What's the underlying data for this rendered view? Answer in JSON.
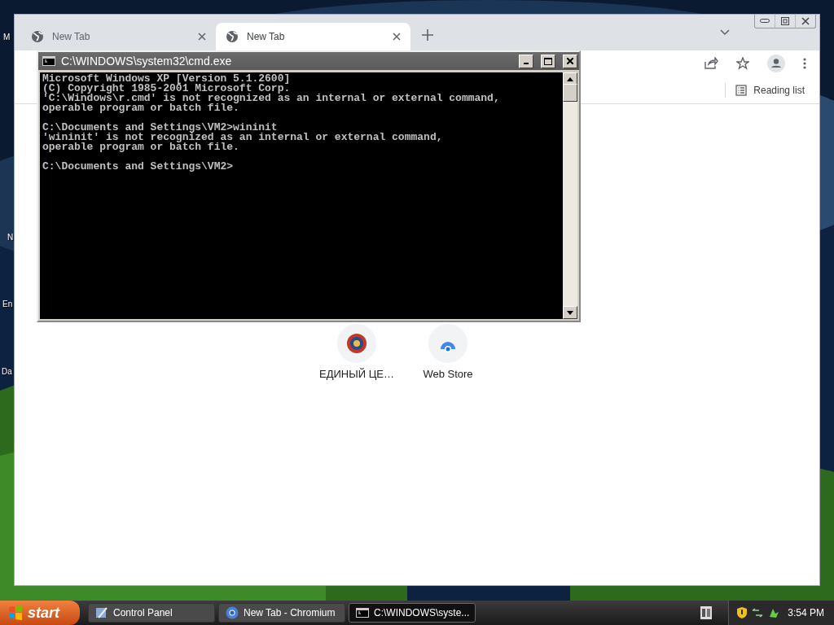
{
  "desktop": {
    "icons": [
      {
        "label": "M"
      },
      {
        "label": "N"
      },
      {
        "label": "En"
      },
      {
        "label": "Da"
      }
    ]
  },
  "browser": {
    "tabs": [
      {
        "title": "New Tab",
        "selected": false
      },
      {
        "title": "New Tab",
        "selected": true
      }
    ],
    "reading_list": "Reading list",
    "shortcuts": [
      {
        "title": "ЕДИНЫЙ ЦЕ…",
        "kind": "emblem"
      },
      {
        "title": "Web Store",
        "kind": "store"
      }
    ]
  },
  "console": {
    "title": "C:\\WINDOWS\\system32\\cmd.exe",
    "blocks": [
      [
        "Microsoft Windows XP [Version 5.1.2600]",
        "(C) Copyright 1985-2001 Microsoft Corp.",
        "'C:\\Windows\\r.cmd' is not recognized as an internal or external command,",
        "operable program or batch file."
      ],
      [
        "C:\\Documents and Settings\\VM2>wininit",
        "'wininit' is not recognized as an internal or external command,",
        "operable program or batch file."
      ],
      [
        "C:\\Documents and Settings\\VM2>"
      ]
    ]
  },
  "taskbar": {
    "start": "start",
    "buttons": [
      {
        "label": "Control Panel",
        "kind": "control-panel",
        "selected": false
      },
      {
        "label": "New Tab - Chromium",
        "kind": "chromium",
        "selected": false
      },
      {
        "label": "C:\\WINDOWS\\syste...",
        "kind": "console",
        "selected": true
      }
    ],
    "clock": "3:54 PM"
  }
}
